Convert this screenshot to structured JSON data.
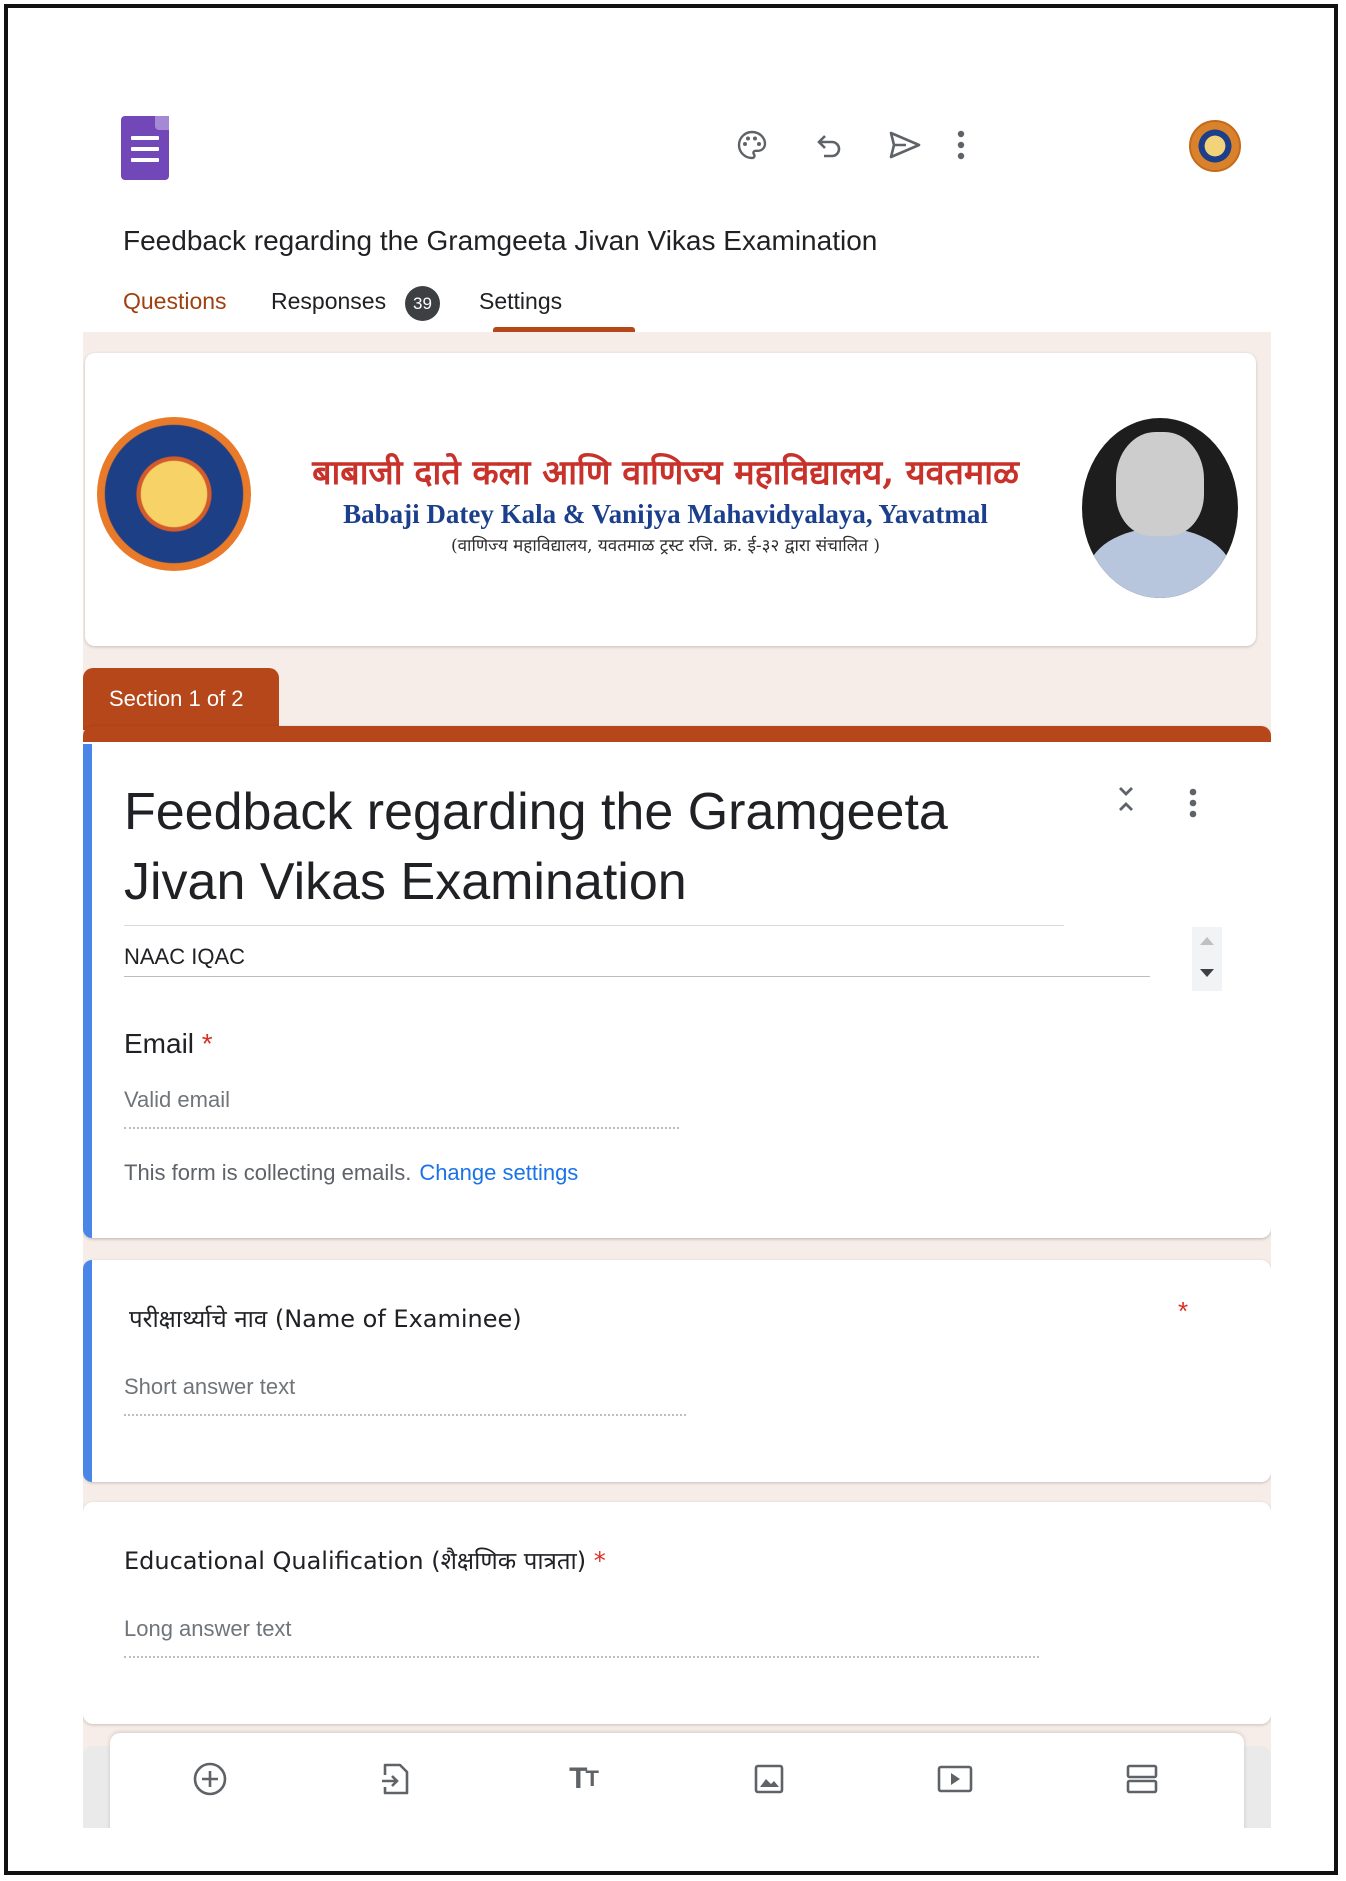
{
  "app": {
    "form_title": "Feedback regarding the Gramgeeta Jivan Vikas Examination",
    "toolbar_icons": [
      "palette-icon",
      "undo-icon",
      "send-icon",
      "more-vert-icon",
      "avatar"
    ],
    "tabs": {
      "questions": "Questions",
      "responses": "Responses",
      "responses_count": "39",
      "settings": "Settings"
    },
    "accent_color": "#b5471a",
    "active_question_color": "#4a86e8"
  },
  "header_image": {
    "college_name_marathi": "बाबाजी दाते कला आणि वाणिज्य महाविद्यालय, यवतमाळ",
    "college_name_english": "Babaji Datey Kala & Vanijya Mahavidyalaya, Yavatmal",
    "trust_line": "(वाणिज्य महाविद्यालय, यवतमाळ ट्रस्ट रजि. क्र. ई-३२ द्वारा संचालित )"
  },
  "section": {
    "label": "Section 1 of 2",
    "title": "Feedback regarding the Gramgeeta Jivan Vikas Examination",
    "description": "NAAC IQAC"
  },
  "email_field": {
    "label": "Email",
    "required_mark": "*",
    "placeholder": "Valid email",
    "collecting_note": "This form is collecting emails.",
    "change_settings_link": "Change settings"
  },
  "questions": [
    {
      "title": "परीक्षार्थ्याचे नाव (Name of Examinee)",
      "required_mark": "*",
      "placeholder": "Short answer text"
    },
    {
      "title": "Educational Qualification (शैक्षणिक पात्रता)",
      "required_mark": "*",
      "placeholder": "Long answer text"
    }
  ],
  "bottom_toolbar_icons": [
    "add-question-icon",
    "import-questions-icon",
    "add-title-icon",
    "add-image-icon",
    "add-video-icon",
    "add-section-icon"
  ]
}
